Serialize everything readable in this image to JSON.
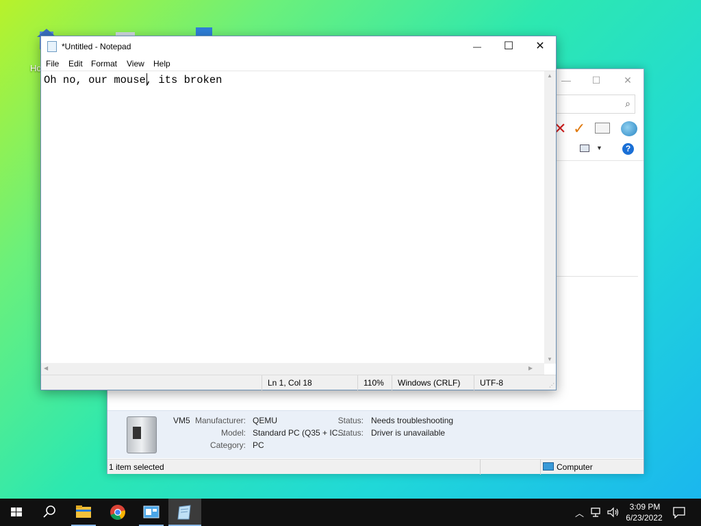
{
  "desktop": {
    "icon_labels": [
      "Ho"
    ]
  },
  "notepad": {
    "title": "*Untitled - Notepad",
    "menu": [
      "File",
      "Edit",
      "Format",
      "View",
      "Help"
    ],
    "content": "Oh no, our mouse, its broken",
    "status": {
      "position": "Ln 1, Col 18",
      "zoom": "110%",
      "line_ending": "Windows (CRLF)",
      "encoding": "UTF-8"
    },
    "controls": {
      "minimize": "—",
      "maximize": "☐",
      "close": "✕"
    }
  },
  "device_window": {
    "details": {
      "name": "VM5",
      "manufacturer_label": "Manufacturer:",
      "manufacturer": "QEMU",
      "model_label": "Model:",
      "model": "Standard PC (Q35 + IC...",
      "category_label": "Category:",
      "category": "PC",
      "status_label": "Status:",
      "status1": "Needs troubleshooting",
      "status2": "Driver is unavailable"
    },
    "status_bar": {
      "selection": "1 item selected",
      "location": "Computer"
    }
  },
  "taskbar": {
    "time": "3:09 PM",
    "date": "6/23/2022"
  },
  "colors": {
    "taskbar": "#101010",
    "accent": "#1a6fd6",
    "red_x": "#d21f1f",
    "check": "#e07a10"
  }
}
